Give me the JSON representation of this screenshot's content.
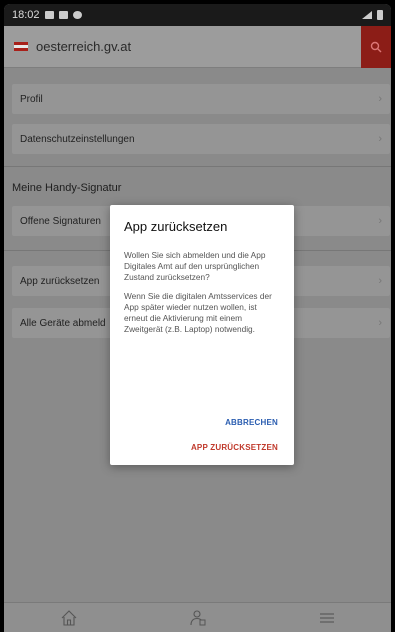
{
  "statusbar": {
    "time": "18:02",
    "signal": "📶"
  },
  "appbar": {
    "title": "oesterreich.gv.at",
    "search_icon": "search-icon"
  },
  "list": {
    "profil": "Profil",
    "datenschutz": "Datenschutzeinstellungen",
    "section_title": "Meine Handy-Signatur",
    "offene": "Offene Signaturen",
    "app_reset": "App zurücksetzen",
    "alle_geraete": "Alle Geräte abmeld",
    "chevron": "›"
  },
  "dialog": {
    "title": "App zurücksetzen",
    "paragraph1": "Wollen Sie sich abmelden und die App Digitales Amt auf den ursprünglichen Zustand zurücksetzen?",
    "paragraph2": "Wenn Sie die digitalen Amtsservices der App später wieder nutzen wollen, ist erneut die Aktivierung mit einem Zweitgerät (z.B. Laptop) notwendig.",
    "cancel": "ABBRECHEN",
    "confirm": "APP ZURÜCKSETZEN"
  },
  "colors": {
    "accent_red": "#c0392b",
    "cancel_blue": "#2a5db0",
    "search_bg": "#8c1d17"
  },
  "bottomnav": {
    "icons": [
      "home-icon",
      "person-icon",
      "menu-icon"
    ]
  }
}
